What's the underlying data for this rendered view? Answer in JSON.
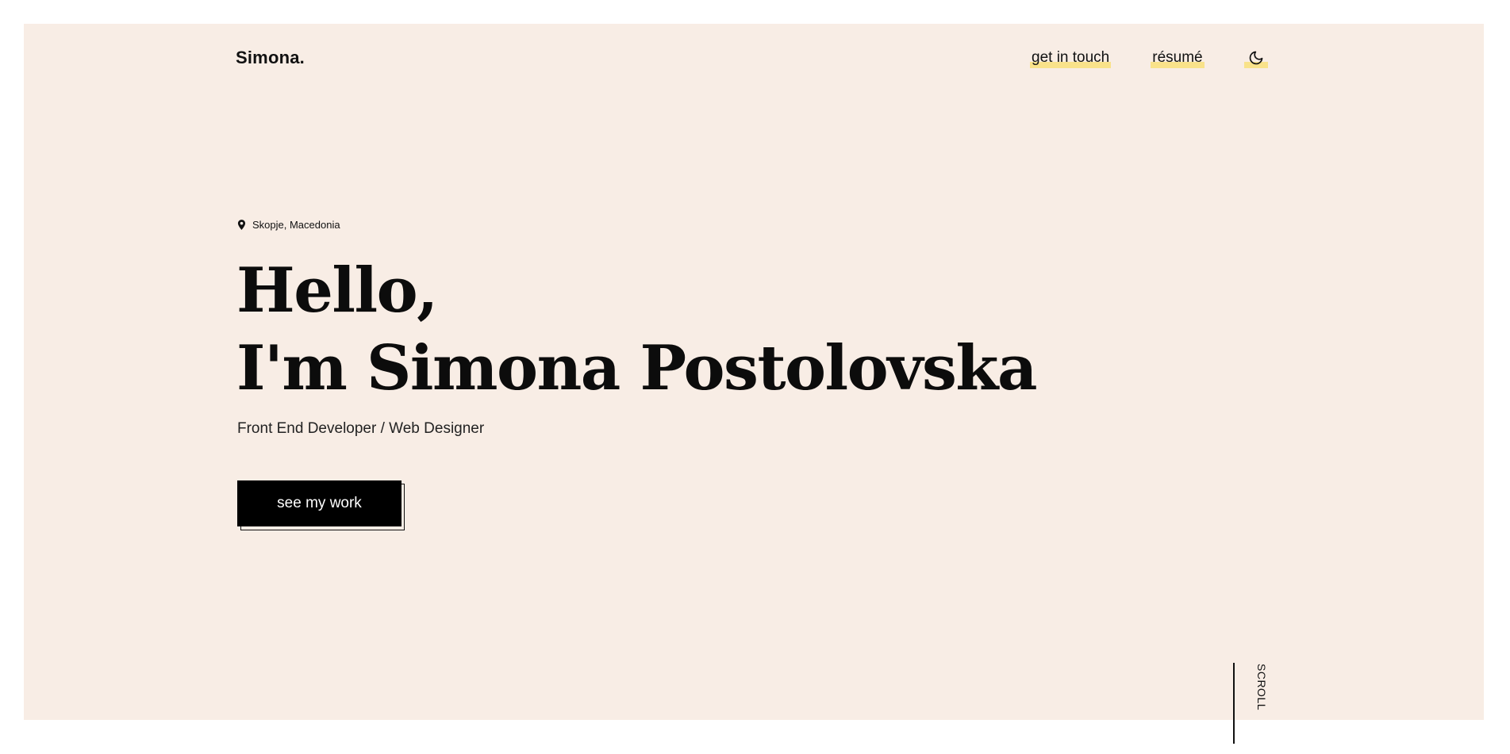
{
  "header": {
    "logo": "Simona.",
    "nav": {
      "get_in_touch": "get in touch",
      "resume": "résumé",
      "theme_toggle_icon": "moon-icon"
    }
  },
  "hero": {
    "location": {
      "icon": "map-pin-icon",
      "text": "Skopje, Macedonia"
    },
    "headline_line1": "Hello,",
    "headline_line2": "I'm Simona Postolovska",
    "subtitle": "Front End Developer / Web Designer",
    "cta_label": "see my work"
  },
  "scroll_indicator": {
    "label": "SCROLL"
  },
  "colors": {
    "background": "#f8ede5",
    "highlight": "#f9e28a",
    "text": "#111111",
    "button": "#000000"
  }
}
